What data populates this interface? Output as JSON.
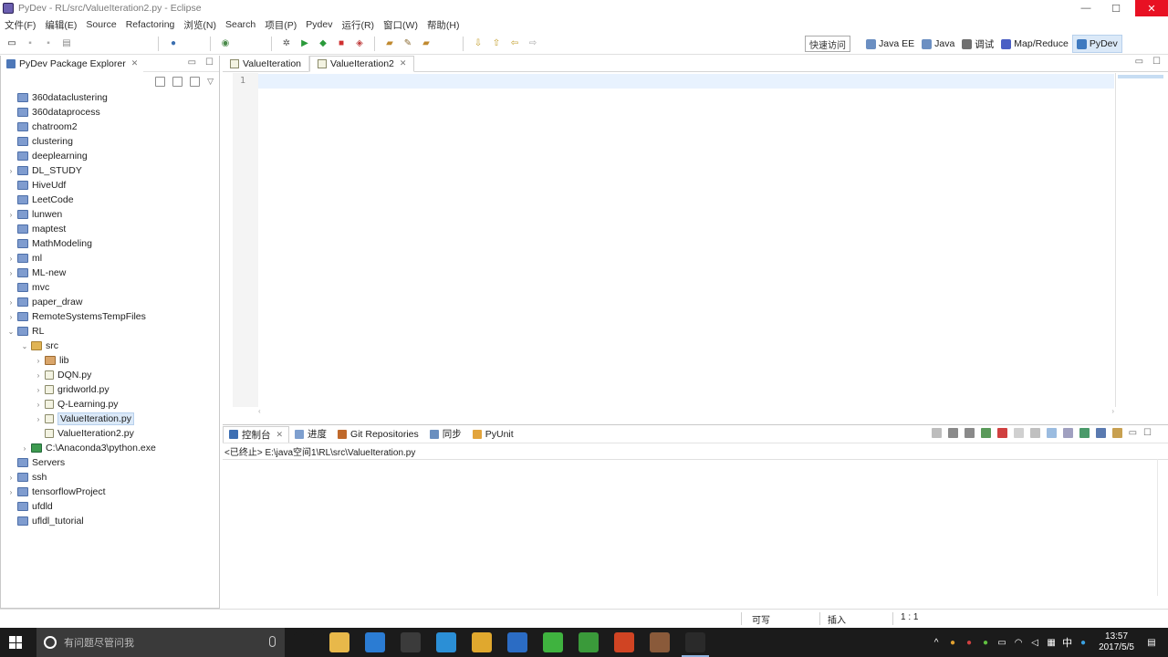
{
  "window": {
    "title": "PyDev - RL/src/ValueIteration2.py - Eclipse",
    "controls": {
      "minimize": "—",
      "maximize": "☐",
      "close": "✕"
    }
  },
  "menu": [
    "文件(F)",
    "编辑(E)",
    "Source",
    "Refactoring",
    "浏览(N)",
    "Search",
    "项目(P)",
    "Pydev",
    "运行(R)",
    "窗口(W)",
    "帮助(H)"
  ],
  "toolbar": {
    "quick_access": "快速访问",
    "perspectives": [
      {
        "label": "Java EE",
        "color": "#6b8fc2"
      },
      {
        "label": "Java",
        "color": "#6b8fc2"
      },
      {
        "label": "调试",
        "color": "#6f6f6f"
      },
      {
        "label": "Map/Reduce",
        "color": "#4b5fc4"
      },
      {
        "label": "PyDev",
        "color": "#3f7ac0"
      }
    ]
  },
  "explorer": {
    "tab_label": "PyDev Package Explorer",
    "close_glyph": "✕",
    "items": [
      {
        "label": "360dataclustering",
        "type": "folder",
        "level": 0,
        "arrow": ""
      },
      {
        "label": "360dataprocess",
        "type": "folder",
        "level": 0,
        "arrow": ""
      },
      {
        "label": "chatroom2",
        "type": "folder",
        "level": 0,
        "arrow": ""
      },
      {
        "label": "clustering",
        "type": "folder",
        "level": 0,
        "arrow": ""
      },
      {
        "label": "deeplearning",
        "type": "folder",
        "level": 0,
        "arrow": ""
      },
      {
        "label": "DL_STUDY",
        "type": "folder",
        "level": 0,
        "arrow": "›"
      },
      {
        "label": "HiveUdf",
        "type": "folder",
        "level": 0,
        "arrow": ""
      },
      {
        "label": "LeetCode",
        "type": "folder",
        "level": 0,
        "arrow": ""
      },
      {
        "label": "lunwen",
        "type": "folder",
        "level": 0,
        "arrow": "›"
      },
      {
        "label": "maptest",
        "type": "folder",
        "level": 0,
        "arrow": ""
      },
      {
        "label": "MathModeling",
        "type": "folder",
        "level": 0,
        "arrow": ""
      },
      {
        "label": "ml",
        "type": "folder",
        "level": 0,
        "arrow": "›"
      },
      {
        "label": "ML-new",
        "type": "folder",
        "level": 0,
        "arrow": "›"
      },
      {
        "label": "mvc",
        "type": "folder",
        "level": 0,
        "arrow": ""
      },
      {
        "label": "paper_draw",
        "type": "folder",
        "level": 0,
        "arrow": "›"
      },
      {
        "label": "RemoteSystemsTempFiles",
        "type": "folder",
        "level": 0,
        "arrow": "›"
      },
      {
        "label": "RL",
        "type": "folder",
        "level": 0,
        "arrow": "⌄"
      },
      {
        "label": "src",
        "type": "src",
        "level": 1,
        "arrow": "⌄"
      },
      {
        "label": "lib",
        "type": "lib",
        "level": 2,
        "arrow": "›"
      },
      {
        "label": "DQN.py",
        "type": "py",
        "level": 2,
        "arrow": "›"
      },
      {
        "label": "gridworld.py",
        "type": "py",
        "level": 2,
        "arrow": "›"
      },
      {
        "label": "Q-Learning.py",
        "type": "py",
        "level": 2,
        "arrow": "›"
      },
      {
        "label": "ValueIteration.py",
        "type": "py",
        "level": 2,
        "arrow": "›",
        "selected": true
      },
      {
        "label": "ValueIteration2.py",
        "type": "py",
        "level": 2,
        "arrow": ""
      },
      {
        "label": "C:\\Anaconda3\\python.exe",
        "type": "interp",
        "level": 1,
        "arrow": "›"
      },
      {
        "label": "Servers",
        "type": "folder",
        "level": 0,
        "arrow": ""
      },
      {
        "label": "ssh",
        "type": "folder",
        "level": 0,
        "arrow": "›"
      },
      {
        "label": "tensorflowProject",
        "type": "folder",
        "level": 0,
        "arrow": "›"
      },
      {
        "label": "ufdld",
        "type": "folder",
        "level": 0,
        "arrow": ""
      },
      {
        "label": "ufldl_tutorial",
        "type": "folder",
        "level": 0,
        "arrow": ""
      }
    ]
  },
  "editor": {
    "tabs": [
      {
        "label": "ValueIteration",
        "active": false
      },
      {
        "label": "ValueIteration2",
        "active": true
      }
    ],
    "close_glyph": "✕",
    "line_numbers": [
      "1"
    ]
  },
  "console": {
    "tabs": [
      {
        "label": "控制台",
        "active": true,
        "color": "#3d6fb3"
      },
      {
        "label": "进度",
        "active": false,
        "color": "#7e9fcf"
      },
      {
        "label": "Git Repositories",
        "active": false,
        "color": "#c0692b"
      },
      {
        "label": "同步",
        "active": false,
        "color": "#6a8fbf"
      },
      {
        "label": "PyUnit",
        "active": false,
        "color": "#e2a43c"
      }
    ],
    "status_line": "<已终止> E:\\java空间1\\RL\\src\\ValueIteration.py"
  },
  "statusbar": {
    "writable": "可写",
    "insert_mode": "插入",
    "position": "1 : 1"
  },
  "taskbar": {
    "search_placeholder": "有问题尽管问我",
    "time": "13:57",
    "date": "2017/5/5",
    "ime": "中",
    "apps": [
      {
        "name": "task-view",
        "color": "#1b1b1b"
      },
      {
        "name": "file-explorer",
        "color": "#e8b84a"
      },
      {
        "name": "edge",
        "color": "#2b7cd3"
      },
      {
        "name": "store",
        "color": "#3b3b3b"
      },
      {
        "name": "qq-browser",
        "color": "#2b8fd6"
      },
      {
        "name": "chrome",
        "color": "#e0a82e"
      },
      {
        "name": "sublime",
        "color": "#2b6cc4"
      },
      {
        "name": "360",
        "color": "#3fb33f"
      },
      {
        "name": "pycharm-green",
        "color": "#3a9a3a"
      },
      {
        "name": "powerpoint",
        "color": "#d04423"
      },
      {
        "name": "eclipse-purple",
        "color": "#8a5a3a"
      },
      {
        "name": "eclipse",
        "color": "#2a2a2a"
      }
    ]
  }
}
